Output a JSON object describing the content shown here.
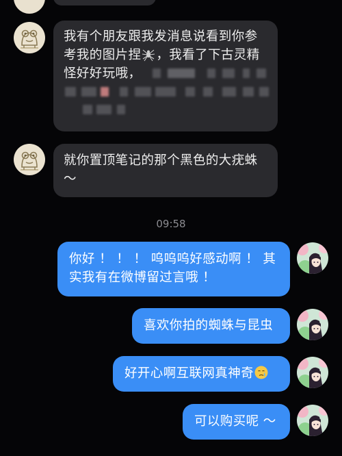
{
  "conversation": {
    "timestamp": "09:58",
    "incoming": [
      {
        "lines": [
          "我有个朋友跟我发消息说看到你参",
          "考我的图片捏",
          "，我看了下古灵精",
          "怪好好玩哦，"
        ],
        "icon": "spider-icon",
        "has_redacted": true
      },
      {
        "lines": [
          "就你置顶笔记的那个黑色的大疣蛛",
          "～"
        ]
      }
    ],
    "outgoing": [
      {
        "lines": [
          "你好 ！ ！ ！ 呜呜呜好感动啊 ！ 其",
          "实我有在微博留过言哦 ！"
        ]
      },
      {
        "lines": [
          "喜欢你拍的蜘蛛与昆虫"
        ]
      },
      {
        "lines": [
          "好开心啊互联网真神奇"
        ],
        "icon": "crying-face-icon"
      },
      {
        "lines": [
          "可以购买呢 ～"
        ]
      }
    ]
  },
  "colors": {
    "background": "#050507",
    "incoming_bubble": "#2a2a2e",
    "outgoing_bubble": "#3a8ef6",
    "timestamp_text": "#8c8c91"
  }
}
